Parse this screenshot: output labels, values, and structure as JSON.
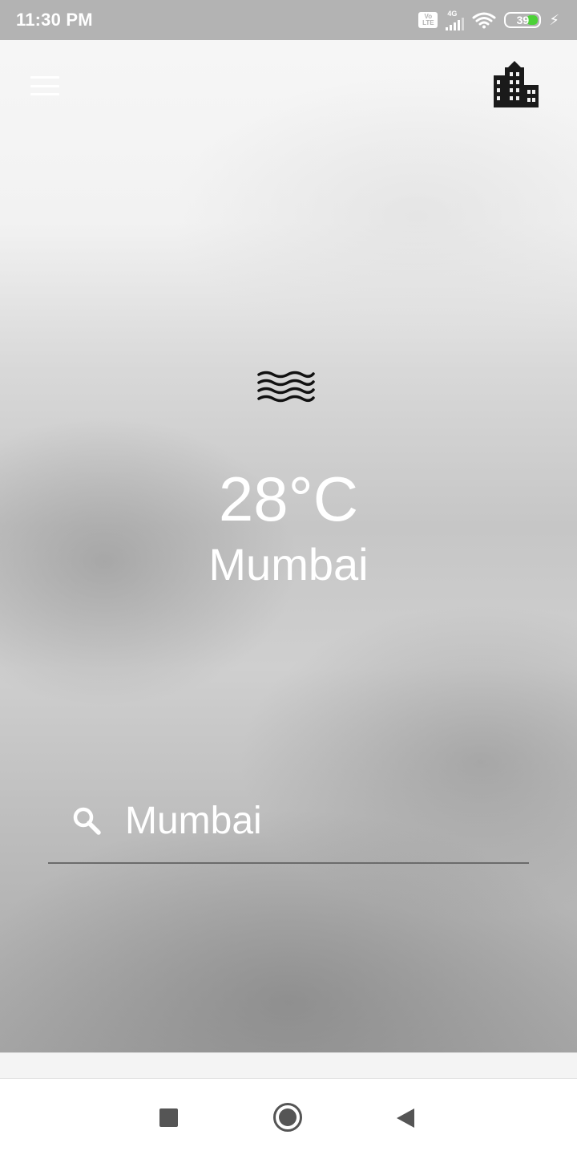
{
  "status_bar": {
    "time": "11:30 PM",
    "volte_top": "Vo",
    "volte_bottom": "LTE",
    "network": "4G",
    "battery_percent": "39",
    "battery_level": 0.39,
    "icons": [
      "volte-icon",
      "signal-icon",
      "wifi-icon",
      "battery-icon",
      "charging-icon"
    ]
  },
  "header": {
    "menu_icon": "hamburger-menu-icon",
    "city_icon": "city-buildings-icon"
  },
  "weather": {
    "condition_icon": "haze-icon",
    "temperature": "28°C",
    "city": "Mumbai"
  },
  "search": {
    "icon": "search-icon",
    "value": "Mumbai",
    "placeholder": ""
  },
  "navigation": {
    "recent_icon": "square-recents-icon",
    "home_icon": "circle-home-icon",
    "back_icon": "triangle-back-icon"
  },
  "colors": {
    "status_bar": "#b3b3b3",
    "text_primary": "#ffffff",
    "battery_fill": "#4cd137",
    "nav_icons": "#555555"
  }
}
